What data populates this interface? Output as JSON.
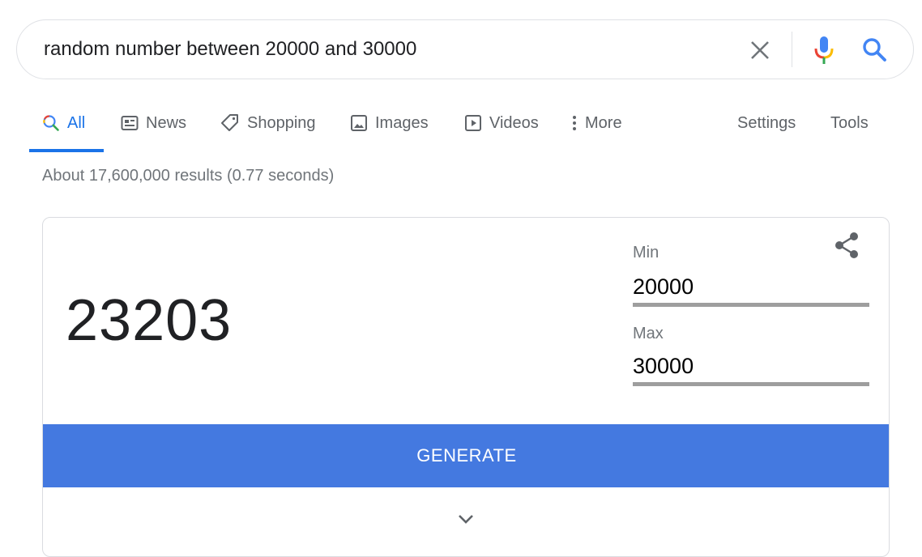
{
  "search": {
    "query": "random number between 20000 and 30000"
  },
  "tabs": [
    {
      "label": "All",
      "icon": "search-icon",
      "active": true
    },
    {
      "label": "News",
      "icon": "news-icon"
    },
    {
      "label": "Shopping",
      "icon": "tag-icon"
    },
    {
      "label": "Images",
      "icon": "image-icon"
    },
    {
      "label": "Videos",
      "icon": "play-icon"
    },
    {
      "label": "More",
      "icon": "more-vert-icon"
    }
  ],
  "tools": {
    "settings_label": "Settings",
    "tools_label": "Tools"
  },
  "stats": "About 17,600,000 results (0.77 seconds)",
  "rng": {
    "result": "23203",
    "min_label": "Min",
    "min_value": "20000",
    "max_label": "Max",
    "max_value": "30000",
    "generate_label": "GENERATE"
  },
  "colors": {
    "accent": "#1a73e8",
    "generate_button": "#4479e0",
    "input_underline": "#9e9e9e"
  }
}
